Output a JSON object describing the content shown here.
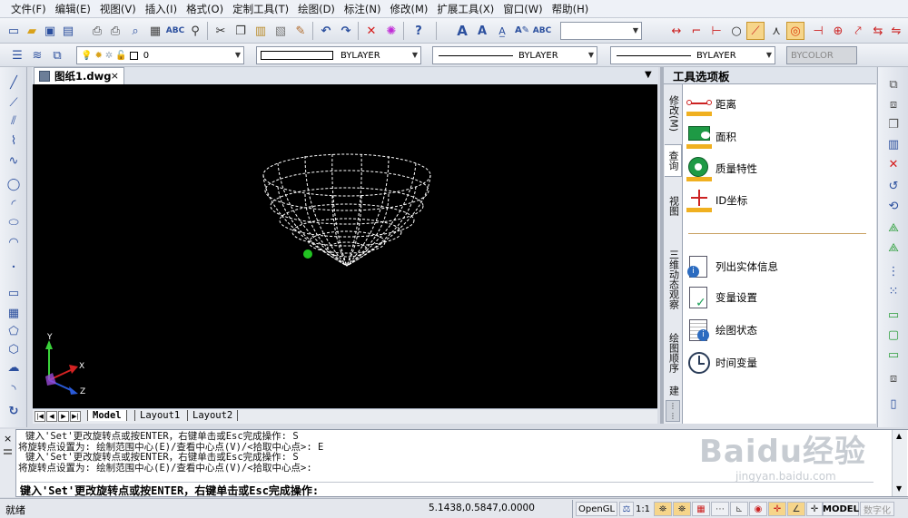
{
  "menu": [
    "文件(F)",
    "编辑(E)",
    "视图(V)",
    "插入(I)",
    "格式(O)",
    "定制工具(T)",
    "绘图(D)",
    "标注(N)",
    "修改(M)",
    "扩展工具(X)",
    "窗口(W)",
    "帮助(H)"
  ],
  "toolbar2": {
    "layer_value": "0",
    "color_value": "BYLAYER",
    "linetype_value": "BYLAYER",
    "lineweight_value": "BYLAYER",
    "plotstyle_value": "BYCOLOR"
  },
  "document": {
    "tab_label": "图纸1.dwg",
    "close_glyph": "×"
  },
  "canvas": {
    "ucs_x": "X",
    "ucs_y": "Y",
    "ucs_z": "Z"
  },
  "layouts": [
    "Model",
    "Layout1",
    "Layout2"
  ],
  "tool_palette": {
    "title": "工具选项板",
    "tabs": [
      "修改(M)",
      "查询",
      "视图",
      "三维动态观察",
      "绘图顺序",
      "建"
    ],
    "items": [
      {
        "label": "距离",
        "icon": "distance-icon"
      },
      {
        "label": "面积",
        "icon": "area-icon"
      },
      {
        "label": "质量特性",
        "icon": "mass-properties-icon"
      },
      {
        "label": "ID坐标",
        "icon": "id-point-icon"
      },
      {
        "label": "列出实体信息",
        "icon": "list-icon"
      },
      {
        "label": "变量设置",
        "icon": "setvar-icon"
      },
      {
        "label": "绘图状态",
        "icon": "status-icon"
      },
      {
        "label": "时间变量",
        "icon": "time-icon"
      }
    ]
  },
  "command": {
    "log": [
      "键入'Set'更改旋转点或按ENTER，右键单击或Esc完成操作: S",
      "将旋转点设置为: 绘制范围中心(E)/查看中心点(V)/<拾取中心点>: E",
      "键入'Set'更改旋转点或按ENTER，右键单击或Esc完成操作: S",
      "将旋转点设置为: 绘制范围中心(E)/查看中心点(V)/<拾取中心点>:"
    ],
    "current": "键入'Set'更改旋转点或按ENTER，右键单击或Esc完成操作:"
  },
  "status": {
    "ready": "就绪",
    "coords": "5.1438,0.5847,0.0000",
    "opengl": "OpenGL",
    "scale": "1:1",
    "model": "MODEL",
    "digitizer": "数字化"
  },
  "watermark": {
    "brand": "Baidu经验",
    "url": "jingyan.baidu.com"
  },
  "colors": {
    "canvas": "#000000",
    "wireframe": "#ffffff",
    "pivot": "#22c322",
    "accent_orange": "#f0a020"
  }
}
